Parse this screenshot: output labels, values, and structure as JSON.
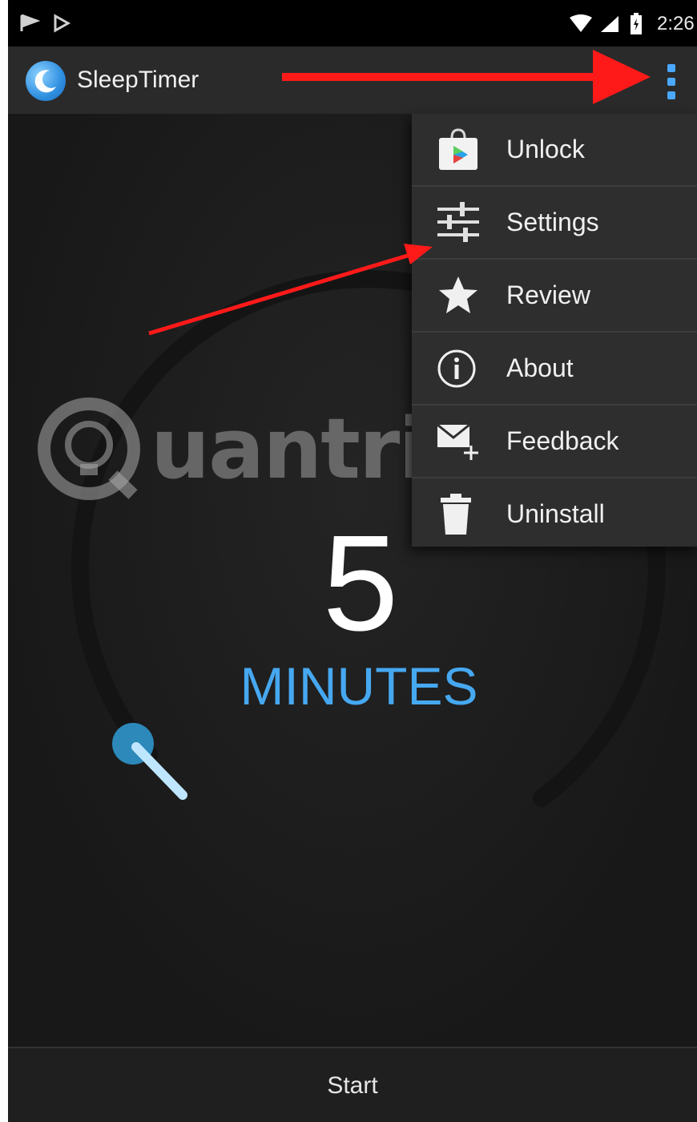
{
  "status_bar": {
    "time": "2:26",
    "icons": [
      "notification-icon",
      "play-store-notification-icon",
      "wifi-icon",
      "signal-icon",
      "battery-icon"
    ]
  },
  "app": {
    "title": "SleepTimer",
    "logo_icon": "moon-icon",
    "overflow_icon": "more-vert-icon"
  },
  "timer": {
    "value": "5",
    "unit": "MINUTES",
    "accent_color": "#46a8f0"
  },
  "menu": {
    "items": [
      {
        "label": "Unlock",
        "icon": "play-store-bag-icon"
      },
      {
        "label": "Settings",
        "icon": "sliders-icon"
      },
      {
        "label": "Review",
        "icon": "star-icon"
      },
      {
        "label": "About",
        "icon": "info-icon"
      },
      {
        "label": "Feedback",
        "icon": "mail-icon"
      },
      {
        "label": "Uninstall",
        "icon": "trash-icon"
      }
    ]
  },
  "bottom_bar": {
    "start_label": "Start"
  },
  "watermark": {
    "text": "uantrimang"
  },
  "colors": {
    "annotation_arrow": "#ff1a1a",
    "action_bar": "#2a2a2a",
    "menu_background": "#2e2e2e"
  }
}
